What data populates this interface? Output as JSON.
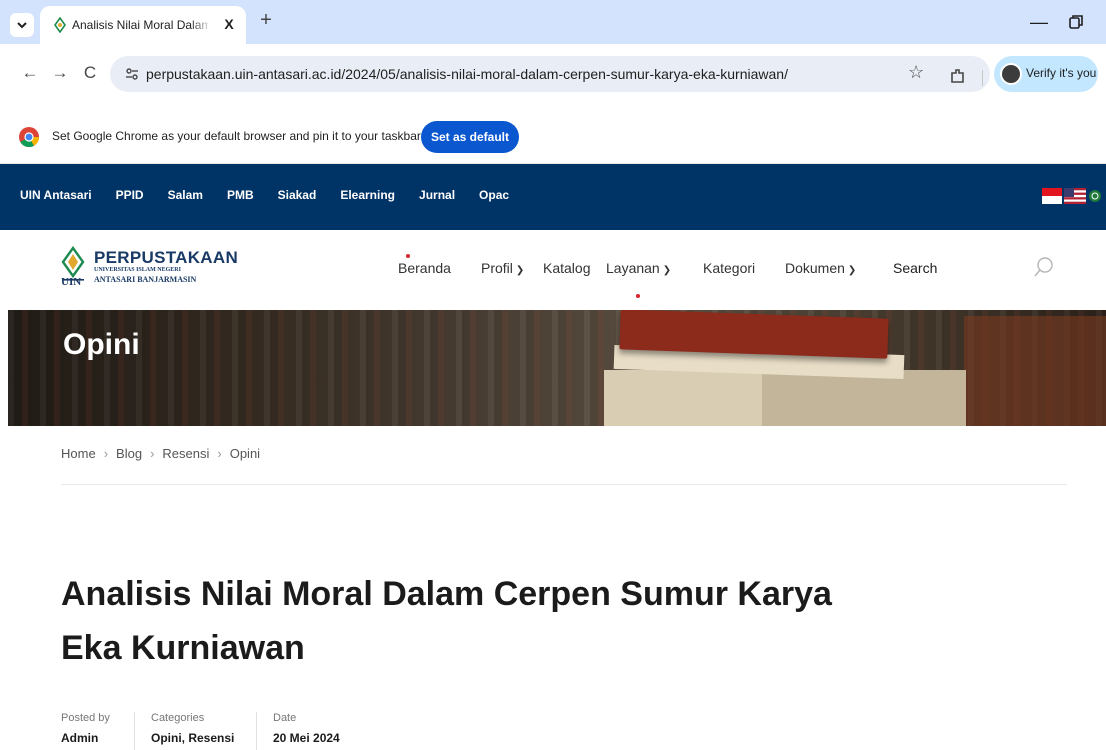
{
  "browser": {
    "tab_title": "Analisis Nilai Moral Dalam Cerp",
    "tab_close": "X",
    "new_tab": "+",
    "url": "perpustakaan.uin-antasari.ac.id/2024/05/analisis-nilai-moral-dalam-cerpen-sumur-karya-eka-kurniawan/",
    "profile_label": "Verify it's you",
    "minimize": "—",
    "nav_back": "←",
    "nav_forward": "→",
    "nav_reload": "C"
  },
  "infobar": {
    "message": "Set Google Chrome as your default browser and pin it to your taskbar",
    "button": "Set as default"
  },
  "top_nav": [
    "UIN Antasari",
    "PPID",
    "Salam",
    "PMB",
    "Siakad",
    "Elearning",
    "Jurnal",
    "Opac"
  ],
  "logo": {
    "title": "PERPUSTAKAAN",
    "line1": "UNIVERSITAS ISLAM NEGERI",
    "line2": "ANTASARI BANJARMASIN",
    "mark": "UIN"
  },
  "main_nav": {
    "beranda": "Beranda",
    "profil": "Profil",
    "katalog": "Katalog",
    "layanan": "Layanan",
    "kategori": "Kategori",
    "dokumen": "Dokumen",
    "search": "Search"
  },
  "hero": {
    "title": "Opini"
  },
  "breadcrumb": {
    "home": "Home",
    "blog": "Blog",
    "resensi": "Resensi",
    "opini": "Opini",
    "separator": "›"
  },
  "article": {
    "title_line1": "Analisis Nilai Moral Dalam Cerpen Sumur Karya",
    "title_line2": "Eka Kurniawan",
    "posted_by_label": "Posted by",
    "posted_by": "Admin",
    "categories_label": "Categories",
    "categories": "Opini, Resensi",
    "date_label": "Date",
    "date": "20 Mei 2024"
  },
  "colors": {
    "site_topbar": "#003366",
    "accent_red": "#d9232d",
    "chrome_blue": "#0b57d0",
    "tabstrip": "#d3e3fd"
  }
}
